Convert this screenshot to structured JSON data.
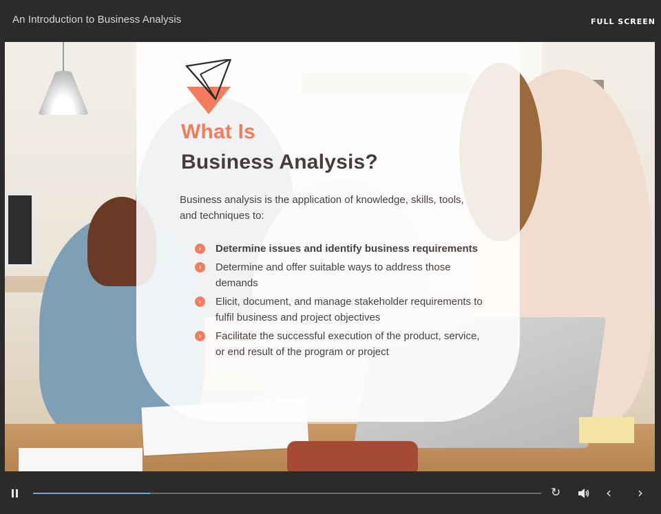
{
  "header": {
    "course_title": "An Introduction to Business Analysis",
    "fullscreen_label": "FULL SCREEN"
  },
  "slide": {
    "heading_line1": "What Is",
    "heading_line2": "Business Analysis?",
    "intro": "Business analysis is the application of knowledge, skills, tools, and techniques to:",
    "bullets": [
      {
        "text": "Determine issues and identify business requirements",
        "bold": true
      },
      {
        "text": "Determine and offer suitable ways to address those demands",
        "bold": false
      },
      {
        "text": "Elicit, document, and manage stakeholder requirements to fulfil business and project objectives",
        "bold": false
      },
      {
        "text": "Facilitate the successful execution of the product, service, or end result of the program or project",
        "bold": false
      }
    ],
    "bullet_icon": "chevron-right-circle-icon",
    "logo_icon": "prism-logo-icon"
  },
  "player": {
    "progress_fraction": 0.23,
    "icons": {
      "pause": "pause-icon",
      "replay": "replay-icon",
      "volume": "volume-icon",
      "previous": "chevron-left-icon",
      "next": "chevron-right-icon"
    }
  },
  "colors": {
    "accent": "#f47c5d",
    "heading_dark": "#4a3b3b",
    "background": "#2b2b2b",
    "progress": "#5fb3d9"
  }
}
